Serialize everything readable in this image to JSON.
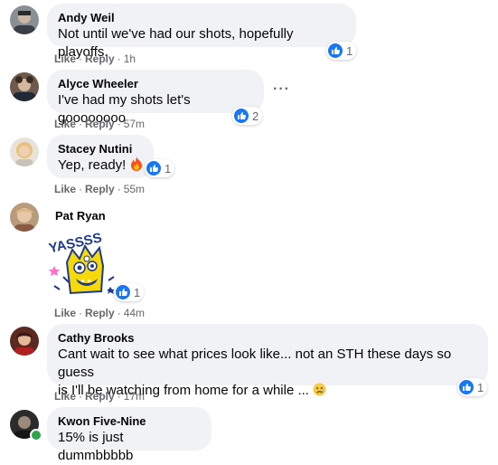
{
  "colors": {
    "bubble": "#f0f2f5",
    "meta": "#65676b",
    "like_blue": "#1877f2",
    "online": "#31a24c"
  },
  "icons": [
    "like-reaction-icon",
    "fire-emoji-icon",
    "sad-emoji-icon",
    "more-options-icon",
    "online-status-icon"
  ],
  "comments": [
    {
      "name": "Andy Weil",
      "text": "Not until we've had our shots, hopefully playoffs.",
      "like": "Like",
      "reply": "Reply",
      "time": "1h",
      "reactions": "1"
    },
    {
      "name": "Alyce Wheeler",
      "text": "I've had my shots let's goooooooo",
      "like": "Like",
      "reply": "Reply",
      "time": "57m",
      "reactions": "2",
      "more": "···"
    },
    {
      "name": "Stacey Nutini",
      "text": "Yep, ready!",
      "like": "Like",
      "reply": "Reply",
      "time": "55m",
      "reactions": "1"
    },
    {
      "name": "Pat Ryan",
      "sticker_text": "YASSSS",
      "like": "Like",
      "reply": "Reply",
      "time": "44m",
      "reactions": "1"
    },
    {
      "name": "Cathy Brooks",
      "text_line1": "Cant wait to see what prices look like... not an STH these days so guess",
      "text_line2": "is I'll be watching from home for a while ...",
      "like": "Like",
      "reply": "Reply",
      "time": "17m",
      "reactions": "1"
    },
    {
      "name": "Kwon Five-Nine",
      "text": "15% is just dummbbbbb"
    }
  ]
}
